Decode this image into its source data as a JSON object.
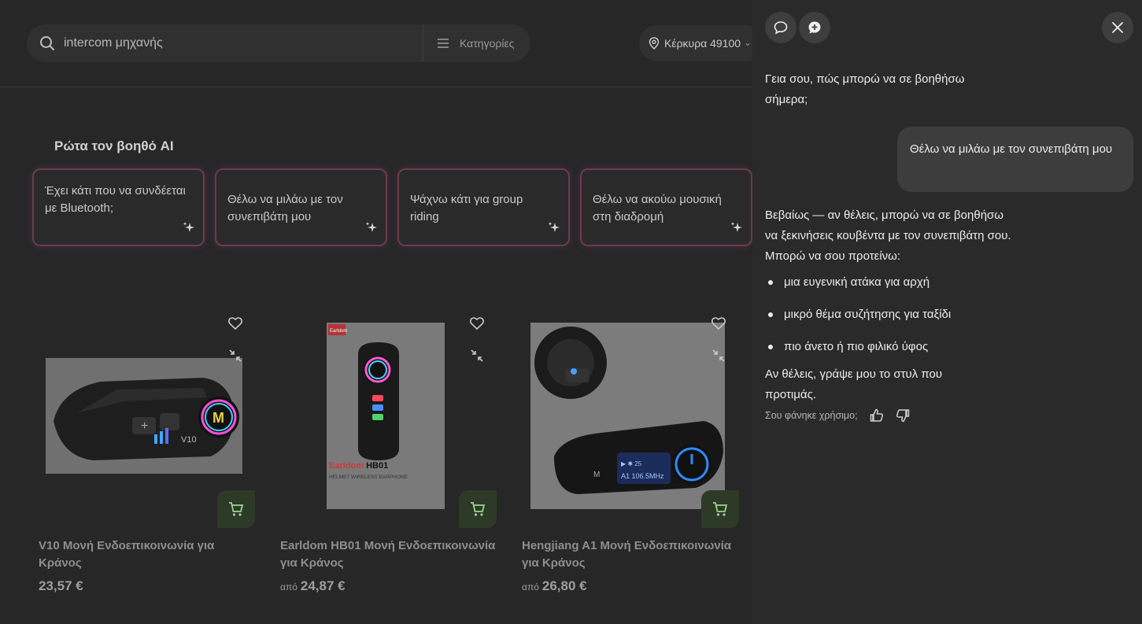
{
  "header": {
    "search_query": "intercom μηχανής",
    "categories_label": "Κατηγορίες",
    "location": "Κέρκυρα 49100"
  },
  "ai_section": {
    "title": "Ρώτα τον βοηθό AI",
    "suggestions": [
      "Έχει κάτι που να συνδέεται με Bluetooth;",
      "Θέλω να μιλάω με τον συνεπιβάτη μου",
      "Ψάχνω κάτι για group riding",
      "Θέλω να ακούω μουσική στη διαδρομή"
    ]
  },
  "products": [
    {
      "name": "V10 Μονή Ενδοεπικοινωνία για Κράνος",
      "price_prefix": "",
      "price": "23,57 €"
    },
    {
      "name": "Earldom HB01 Μονή Ενδοεπικοινωνία για Κράνος",
      "price_prefix": "από",
      "price": "24,87 €"
    },
    {
      "name": "Hengjiang A1 Μονή Ενδοεπικοινωνία για Κράνος",
      "price_prefix": "από",
      "price": "26,80 €"
    }
  ],
  "product_image_text": {
    "earldom_logo": "Earldom",
    "earldom_brand": "Earldom",
    "earldom_model": "HB01",
    "earldom_sub": "HELMET WIRELESS EARPHONE",
    "v10_label": "V10",
    "a1_freq": "A1 106.5MHz"
  },
  "chat": {
    "greeting": "Γεια σου, πώς μπορώ να σε βοηθήσω σήμερα;",
    "user_message": "Θέλω να μιλάω με τον συνεπιβάτη μου",
    "reply_intro": "Βεβαίως — αν θέλεις, μπορώ να σε βοηθήσω να ξεκινήσεις κουβέντα με τον συνεπιβάτη σου. Μπορώ να σου προτείνω:",
    "reply_bullets": [
      "μια ευγενική ατάκα για αρχή",
      "μικρό θέμα συζήτησης για ταξίδι",
      "πιο άνετο ή πιο φιλικό ύφος"
    ],
    "reply_end": "Αν θέλεις, γράψε μου το στυλ που προτιμάς.",
    "feedback_question": "Σου φάνηκε χρήσιμο;"
  },
  "colors": {
    "panel_bg": "#2a2a2a",
    "page_bg": "#272727",
    "user_bubble": "#3d3d3d",
    "cart_bg": "#2d3a27",
    "suggest_border": "#6e3b4a"
  }
}
